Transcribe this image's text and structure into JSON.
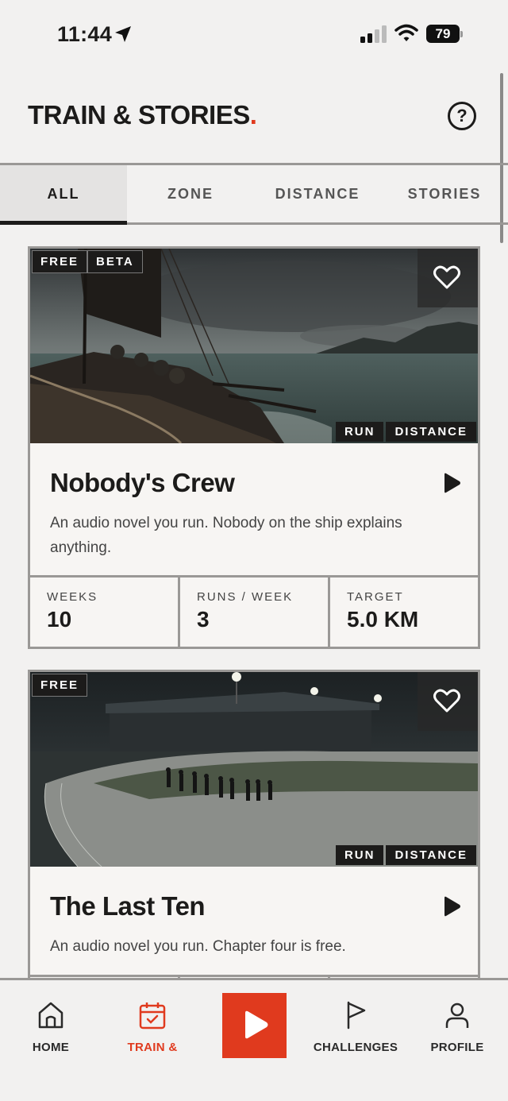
{
  "status_bar": {
    "time": "11:44",
    "battery": "79"
  },
  "header": {
    "title": "TRAIN & STORIES",
    "title_dot": ".",
    "help_icon_label": "?",
    "accent_color": "#e03a1e"
  },
  "tabs": [
    {
      "label": "ALL",
      "active": true
    },
    {
      "label": "ZONE",
      "active": false
    },
    {
      "label": "DISTANCE",
      "active": false
    },
    {
      "label": "STORIES",
      "active": false
    }
  ],
  "cards": [
    {
      "badges": [
        "FREE",
        "BETA"
      ],
      "tags": [
        "RUN",
        "DISTANCE"
      ],
      "title": "Nobody's Crew",
      "description": "An audio novel you run. Nobody on the ship explains anything.",
      "stats": [
        {
          "label": "WEEKS",
          "value": "10"
        },
        {
          "label": "RUNS / WEEK",
          "value": "3"
        },
        {
          "label": "TARGET",
          "value": "5.0 KM"
        }
      ]
    },
    {
      "badges": [
        "FREE"
      ],
      "tags": [
        "RUN",
        "DISTANCE"
      ],
      "title": "The Last Ten",
      "description": "An audio novel you run. Chapter four is free."
    }
  ],
  "bottom_nav": [
    {
      "label": "HOME",
      "icon": "home-icon",
      "active": false
    },
    {
      "label": "TRAIN &",
      "icon": "calendar-check-icon",
      "active": true
    },
    {
      "label": "CHALLENGES",
      "icon": "flag-icon",
      "active": false
    },
    {
      "label": "PROFILE",
      "icon": "person-icon",
      "active": false
    }
  ]
}
